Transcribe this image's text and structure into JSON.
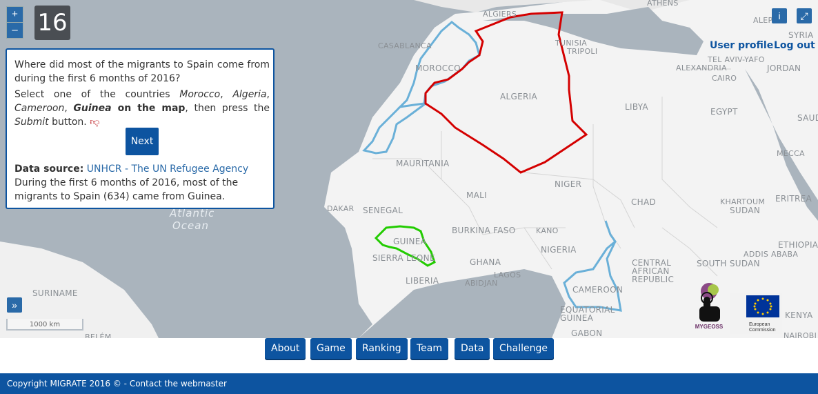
{
  "level": "16",
  "zoom": {
    "in_label": "+",
    "out_label": "–"
  },
  "question": {
    "text": "Where did most of the migrants to Spain come from during the first 6 months of 2016?",
    "instr_pre": "Select one of the countries ",
    "c1": "Morocco",
    "sep1": ", ",
    "c2": "Algeria",
    "sep2": ", ",
    "c3": "Cameroon",
    "sep3": ", ",
    "c4": "Guinea",
    "instr_mid": " on the map",
    "instr_post1": ", then press the ",
    "submit_word": "Submit",
    "instr_post2": " button.",
    "next_label": "Next",
    "source_label": "Data source:",
    "source_link": "UNHCR - The UN Refugee Agency",
    "answer": "During the first 6 months of 2016, most of the migrants to Spain (634) came from Guinea."
  },
  "header": {
    "info_label": "i",
    "fullscreen_label": "⤢",
    "user_profile": "User profile",
    "log_out": "Log out"
  },
  "map": {
    "expand_label": "»",
    "scale": "1000 km",
    "labels": {
      "algiers": "ALGIERS",
      "athens": "ATHENS",
      "tunisia": "TUNISIA",
      "tripoli": "TRIPOLI",
      "casablanca": "CASABLANCA",
      "morocco": "MOROCCO",
      "algeria": "ALGERIA",
      "libya": "LIBYA",
      "egypt": "EGYPT",
      "alexandria": "ALEXANDRIA",
      "tel_aviv": "TEL AVIV-YAFO",
      "jordan": "JORDAN",
      "cairo": "CAIRO",
      "aleppo": "ALEPPO",
      "syria": "SYRIA",
      "saudi": "SAUDI",
      "mecca": "MECCA",
      "mauritania": "MAURITANIA",
      "niger": "NIGER",
      "mali": "MALI",
      "chad": "CHAD",
      "khartoum": "KHARTOUM",
      "sudan": "SUDAN",
      "eritrea": "ERITREA",
      "dakar": "DAKAR",
      "senegal": "SENEGAL",
      "burkina": "BURKINA FASO",
      "kano": "KANO",
      "guinea": "GUINEA",
      "sierra_leone": "SIERRA LEONE",
      "nigeria": "NIGERIA",
      "ethiopia": "ETHIOPIA",
      "south_sudan": "SOUTH SUDAN",
      "addis": "ADDIS ABABA",
      "ghana": "GHANA",
      "lagos": "LAGOS",
      "car1": "CENTRAL",
      "car2": "AFRICAN",
      "car3": "REPUBLIC",
      "liberia": "LIBERIA",
      "abidjan": "ABIDJAN",
      "cameroon": "CAMEROON",
      "suriname": "SURINAME",
      "eq1": "EQUATORIAL",
      "eq2": "GUINEA",
      "gabon": "GABON",
      "kenya": "KENYA",
      "nairobi": "NAIROBI",
      "belem": "BELÉM",
      "atlantic": "Atlantic",
      "ocean": "Ocean"
    }
  },
  "logos": {
    "mygeoss": "MYGEOSS",
    "ec1": "European",
    "ec2": "Commission"
  },
  "nav": [
    "About",
    "Game",
    "Ranking",
    "Team",
    "Data",
    "Challenge"
  ],
  "footer": {
    "copyright": "Copyright MIGRATE 2016 © - ",
    "contact": "Contact the webmaster"
  },
  "colors": {
    "algeria_border": "#d40000",
    "guinea_border": "#22cc00",
    "blue_borders": "#6ab0d8",
    "brand": "#0d54a0"
  }
}
